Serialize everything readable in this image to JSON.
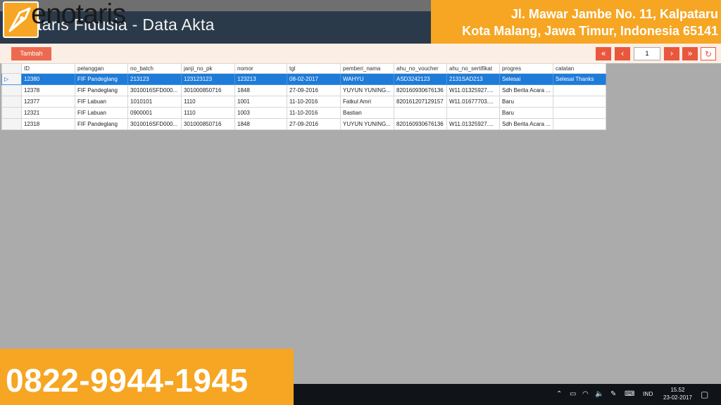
{
  "window": {
    "title": "otaris Fidusia - Data Akta"
  },
  "brand": {
    "name": "enotaris"
  },
  "address": {
    "line1": "Jl. Mawar Jambe No. 11, Kalpataru",
    "line2": "Kota Malang, Jawa Timur, Indonesia 65141"
  },
  "phone": "0822-9944-1945",
  "toolbar": {
    "add_label": "Tambah"
  },
  "pager": {
    "first": "«",
    "prev": "‹",
    "page": "1",
    "next": "›",
    "last": "»",
    "refresh": "↻"
  },
  "colors": {
    "accent": "#e9573d",
    "selection": "#1e7bd8",
    "banner": "#f6a623",
    "titlebar": "#2a3a4a"
  },
  "table": {
    "row_marker": "▷",
    "columns": [
      "ID",
      "pelanggan",
      "no_batch",
      "janji_no_pk",
      "nomor",
      "tgl",
      "pemberi_nama",
      "ahu_no_voucher",
      "ahu_no_sertifikat",
      "progres",
      "catatan"
    ],
    "rows": [
      [
        "12380",
        "FIF Pandeglang",
        "213123",
        "123123123",
        "123213",
        "08-02-2017",
        "WAHYU",
        "ASD3242123",
        "2131SAD213",
        "Selesai",
        "Selesai Thanks"
      ],
      [
        "12378",
        "FIF Pandeglang",
        "3010016SFD000...",
        "301000850716",
        "1848",
        "27-09-2016",
        "YUYUN YUNING...",
        "820160930676136",
        "W11.01325927....",
        "Sdh Berita Acara ...",
        ""
      ],
      [
        "12377",
        "FIF Labuan",
        "1010101",
        "1110",
        "1001",
        "11-10-2016",
        "Fatkul Amri",
        "820161207129157",
        "W11.01677703....",
        "Baru",
        ""
      ],
      [
        "12321",
        "FIF Labuan",
        "0900001",
        "1110",
        "1003",
        "11-10-2016",
        "Bastian",
        "",
        "",
        "Baru",
        ""
      ],
      [
        "12318",
        "FIF Pandeglang",
        "3010016SFD000...",
        "301000850716",
        "1848",
        "27-09-2016",
        "YUYUN YUNING...",
        "820160930676136",
        "W11.01325927....",
        "Sdh Berita Acara ...",
        ""
      ]
    ]
  },
  "taskbar": {
    "lang": "IND",
    "time": "15.52",
    "date": "23-02-2017"
  }
}
